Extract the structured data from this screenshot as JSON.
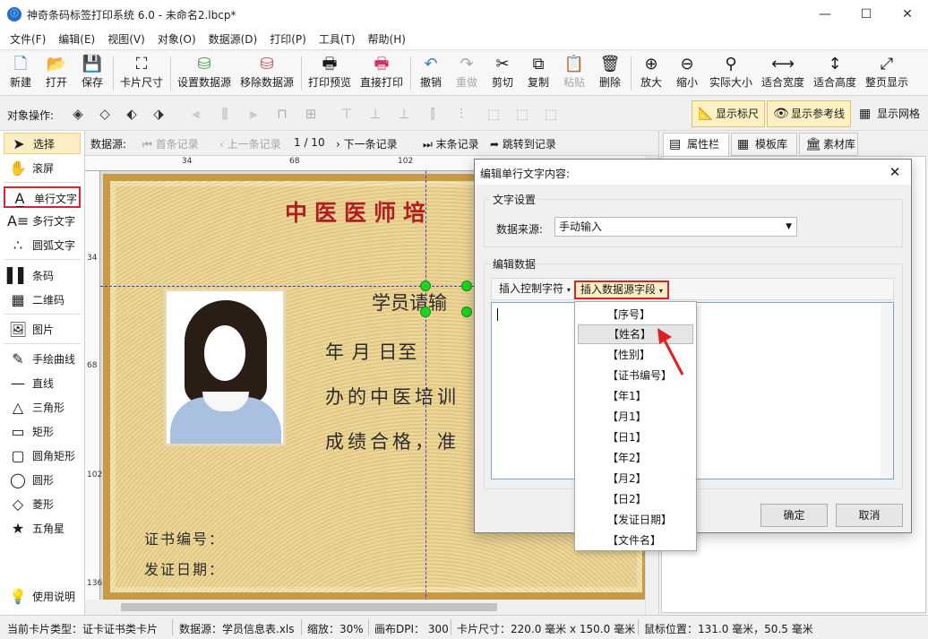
{
  "window": {
    "title": "神奇条码标签打印系统 6.0 - 未命名2.lbcp*",
    "app_icon": "ⓘ",
    "controls": [
      "—",
      "☐",
      "✕"
    ]
  },
  "menu": [
    "文件(F)",
    "编辑(E)",
    "视图(V)",
    "对象(O)",
    "数据源(D)",
    "打印(P)",
    "工具(T)",
    "帮助(H)"
  ],
  "toolbar": [
    {
      "label": "新建",
      "icon": "new-file-icon",
      "glyph": "🗋",
      "enabled": true
    },
    {
      "label": "打开",
      "icon": "open-icon",
      "glyph": "📂",
      "enabled": true
    },
    {
      "label": "保存",
      "icon": "save-icon",
      "glyph": "💾",
      "enabled": true
    },
    {
      "label": "卡片尺寸",
      "icon": "card-size-icon",
      "glyph": "⛶",
      "enabled": true
    },
    {
      "label": "设置数据源",
      "icon": "set-datasource-icon",
      "glyph": "⛁",
      "enabled": true
    },
    {
      "label": "移除数据源",
      "icon": "remove-datasource-icon",
      "glyph": "⛁",
      "enabled": true
    },
    {
      "label": "打印预览",
      "icon": "print-preview-icon",
      "glyph": "🖶",
      "enabled": true
    },
    {
      "label": "直接打印",
      "icon": "print-icon",
      "glyph": "🖶",
      "enabled": true
    },
    {
      "label": "撤销",
      "icon": "undo-icon",
      "glyph": "↶",
      "enabled": true
    },
    {
      "label": "重做",
      "icon": "redo-icon",
      "glyph": "↷",
      "enabled": false
    },
    {
      "label": "剪切",
      "icon": "cut-icon",
      "glyph": "✂",
      "enabled": true
    },
    {
      "label": "复制",
      "icon": "copy-icon",
      "glyph": "⧉",
      "enabled": true
    },
    {
      "label": "粘贴",
      "icon": "paste-icon",
      "glyph": "📋",
      "enabled": false
    },
    {
      "label": "删除",
      "icon": "delete-icon",
      "glyph": "🗑",
      "enabled": true
    },
    {
      "label": "放大",
      "icon": "zoom-in-icon",
      "glyph": "⊕",
      "enabled": true
    },
    {
      "label": "缩小",
      "icon": "zoom-out-icon",
      "glyph": "⊖",
      "enabled": true
    },
    {
      "label": "实际大小",
      "icon": "actual-size-icon",
      "glyph": "⚲",
      "enabled": true
    },
    {
      "label": "适合宽度",
      "icon": "fit-width-icon",
      "glyph": "⟷",
      "enabled": true
    },
    {
      "label": "适合高度",
      "icon": "fit-height-icon",
      "glyph": "↕",
      "enabled": true
    },
    {
      "label": "整页显示",
      "icon": "fit-page-icon",
      "glyph": "⤢",
      "enabled": true
    }
  ],
  "object_bar": {
    "label": "对象操作:",
    "toggles": [
      {
        "label": "显示标尺",
        "icon": "ruler-icon",
        "glyph": "📐",
        "active": true
      },
      {
        "label": "显示参考线",
        "icon": "eye-icon",
        "glyph": "👁",
        "active": true
      },
      {
        "label": "显示网格",
        "icon": "grid-icon",
        "glyph": "▦",
        "active": false
      }
    ]
  },
  "tools": [
    {
      "label": "选择",
      "icon": "cursor-icon",
      "glyph": "➤",
      "state": "selected"
    },
    {
      "label": "滚屏",
      "icon": "hand-icon",
      "glyph": "✋",
      "state": ""
    },
    {
      "label": "单行文字",
      "icon": "single-line-text-icon",
      "glyph": "A̲",
      "state": "highlighted"
    },
    {
      "label": "多行文字",
      "icon": "multi-line-text-icon",
      "glyph": "A≡",
      "state": ""
    },
    {
      "label": "圆弧文字",
      "icon": "arc-text-icon",
      "glyph": "∴",
      "state": ""
    },
    {
      "label": "条码",
      "icon": "barcode-icon",
      "glyph": "▌▌",
      "state": ""
    },
    {
      "label": "二维码",
      "icon": "qrcode-icon",
      "glyph": "▦",
      "state": ""
    },
    {
      "label": "图片",
      "icon": "image-icon",
      "glyph": "🖼",
      "state": ""
    },
    {
      "label": "手绘曲线",
      "icon": "pen-icon",
      "glyph": "✎",
      "state": ""
    },
    {
      "label": "直线",
      "icon": "line-icon",
      "glyph": "—",
      "state": ""
    },
    {
      "label": "三角形",
      "icon": "triangle-icon",
      "glyph": "△",
      "state": ""
    },
    {
      "label": "矩形",
      "icon": "rectangle-icon",
      "glyph": "▭",
      "state": ""
    },
    {
      "label": "圆角矩形",
      "icon": "rounded-rectangle-icon",
      "glyph": "▢",
      "state": ""
    },
    {
      "label": "圆形",
      "icon": "circle-icon",
      "glyph": "◯",
      "state": ""
    },
    {
      "label": "菱形",
      "icon": "diamond-icon",
      "glyph": "◇",
      "state": ""
    },
    {
      "label": "五角星",
      "icon": "star-icon",
      "glyph": "★",
      "state": ""
    }
  ],
  "help_tool": {
    "label": "使用说明",
    "icon": "lightbulb-icon",
    "glyph": "💡"
  },
  "record_nav": {
    "datasource_label": "数据源:",
    "first": "首条记录",
    "prev": "上一条记录",
    "position": "1 / 10",
    "next": "下一条记录",
    "last": "末条记录",
    "jump": "跳转到记录"
  },
  "ruler": {
    "top_ticks": [
      "34",
      "68",
      "102"
    ],
    "left_ticks": [
      "34",
      "68",
      "102",
      "136"
    ]
  },
  "certificate": {
    "title": "中医医师培",
    "line0": "学员请输",
    "line1": "年    月    日至",
    "line2": "办的中医培训",
    "line3": "成绩合格，准",
    "cert_no_label": "证书编号：",
    "issue_date_label": "发证日期："
  },
  "right_panel": {
    "tabs": [
      {
        "label": "属性栏",
        "icon": "properties-icon",
        "glyph": "▤"
      },
      {
        "label": "模板库",
        "icon": "template-icon",
        "glyph": "▦"
      },
      {
        "label": "素材库",
        "icon": "library-icon",
        "glyph": "🏛"
      }
    ]
  },
  "dialog": {
    "title": "编辑单行文字内容:",
    "text_settings_group": "文字设置",
    "datasource_label": "数据来源:",
    "datasource_value": "手动输入",
    "edit_data_group": "编辑数据",
    "insert_control_char": "插入控制字符",
    "insert_field": "插入数据源字段",
    "ok": "确定",
    "cancel": "取消"
  },
  "field_dropdown": {
    "items": [
      "【序号】",
      "【姓名】",
      "【性别】",
      "【证书编号】",
      "【年1】",
      "【月1】",
      "【日1】",
      "【年2】",
      "【月2】",
      "【日2】",
      "【发证日期】",
      "【文件名】"
    ],
    "hovered": "【姓名】"
  },
  "status_bar": {
    "card_type": "当前卡片类型：证卡证书类卡片",
    "datasource": "数据源：学员信息表.xls",
    "zoom": "缩放：30%",
    "dpi": "画布DPI：  300",
    "card_size": "卡片尺寸：220.0 毫米 x 150.0 毫米",
    "mouse_pos": "鼠标位置：131.0 毫米，50.5 毫米"
  },
  "accent_colors": {
    "highlight_red": "#d9232e",
    "selected_bg": "#fbeec3",
    "handle_green": "#22d422",
    "title_red": "#b01e23"
  }
}
